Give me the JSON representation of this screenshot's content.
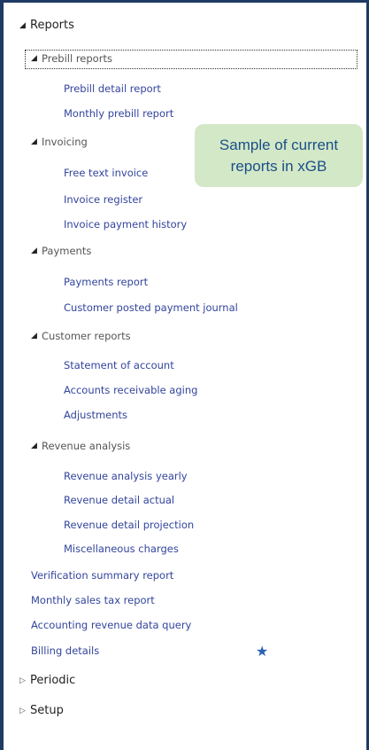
{
  "nav": {
    "reports": "Reports",
    "prebill": {
      "label": "Prebill reports",
      "items": [
        "Prebill detail report",
        "Monthly prebill report"
      ]
    },
    "invoicing": {
      "label": "Invoicing",
      "items": [
        "Free text invoice",
        "Invoice register",
        "Invoice payment history"
      ]
    },
    "payments": {
      "label": "Payments",
      "items": [
        "Payments report",
        "Customer posted payment journal"
      ]
    },
    "customer_reports": {
      "label": "Customer reports",
      "items": [
        "Statement of account",
        "Accounts receivable aging",
        "Adjustments"
      ]
    },
    "revenue_analysis": {
      "label": "Revenue analysis",
      "items": [
        "Revenue analysis yearly",
        "Revenue detail actual",
        "Revenue detail projection",
        "Miscellaneous charges"
      ]
    },
    "standalone": [
      "Verification summary report",
      "Monthly sales tax report",
      "Accounting revenue data query",
      "Billing details"
    ],
    "periodic": "Periodic",
    "setup": "Setup"
  },
  "callout": {
    "line1": "Sample of current",
    "line2": "reports in xGB"
  },
  "icons": {
    "expanded": "triangle-down-right",
    "collapsed": "triangle-right-outline",
    "favorite": "star"
  },
  "colors": {
    "link": "#33459c",
    "frame": "#1f3a63",
    "callout_bg": "#d3e8c6",
    "callout_text": "#1b4f8a",
    "star": "#2a63b0"
  }
}
